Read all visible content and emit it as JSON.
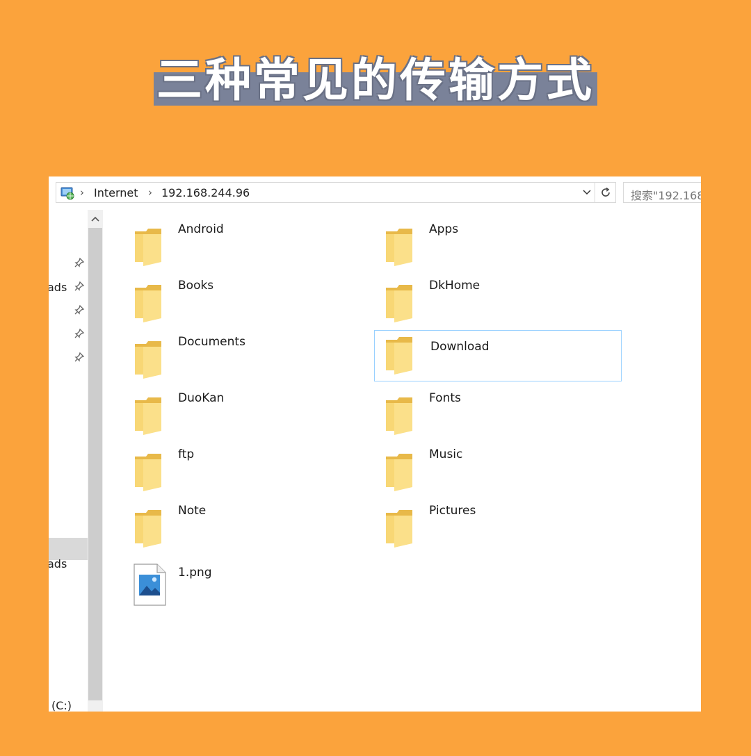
{
  "banner": {
    "title": "三种常见的传输方式"
  },
  "address_bar": {
    "crumbs": [
      "Internet",
      "192.168.244.96"
    ],
    "search_placeholder": "搜索\"192.168."
  },
  "nav_pane": {
    "labels": [
      {
        "text": "ads"
      },
      {
        "text": "ads"
      },
      {
        "text": "(C:)"
      }
    ]
  },
  "items": [
    {
      "label": "Android",
      "type": "folder",
      "selected": false
    },
    {
      "label": "Apps",
      "type": "folder",
      "selected": false
    },
    {
      "label": "Books",
      "type": "folder",
      "selected": false
    },
    {
      "label": "DkHome",
      "type": "folder",
      "selected": false
    },
    {
      "label": "Documents",
      "type": "folder",
      "selected": false
    },
    {
      "label": "Download",
      "type": "folder",
      "selected": true
    },
    {
      "label": "DuoKan",
      "type": "folder",
      "selected": false
    },
    {
      "label": "Fonts",
      "type": "folder",
      "selected": false
    },
    {
      "label": "ftp",
      "type": "folder",
      "selected": false
    },
    {
      "label": "Music",
      "type": "folder",
      "selected": false
    },
    {
      "label": "Note",
      "type": "folder",
      "selected": false
    },
    {
      "label": "Pictures",
      "type": "folder",
      "selected": false
    },
    {
      "label": "1.png",
      "type": "image-file",
      "selected": false
    }
  ],
  "colors": {
    "background": "#FBA33C",
    "title_highlight": "#7a8299",
    "folder": "#F8D775",
    "selection_border": "#99d1ff"
  }
}
